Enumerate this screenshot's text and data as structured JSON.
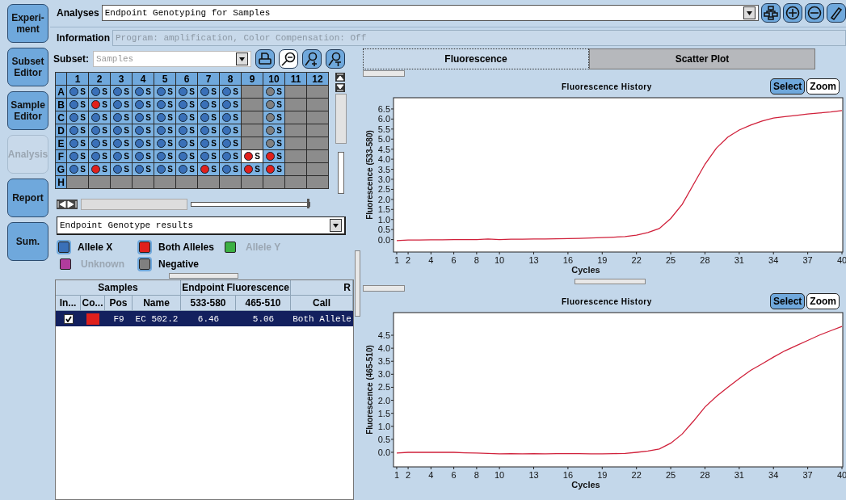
{
  "sidebar": {
    "items": [
      {
        "label": "Experi-ment",
        "disabled": false
      },
      {
        "label": "Subset Editor",
        "disabled": false
      },
      {
        "label": "Sample Editor",
        "disabled": false
      },
      {
        "label": "Analysis",
        "disabled": true
      },
      {
        "label": "Report",
        "disabled": false
      },
      {
        "label": "Sum.",
        "disabled": false
      }
    ]
  },
  "analyses": {
    "label": "Analyses",
    "value": "Endpoint Genotyping for Samples"
  },
  "information": {
    "label": "Information",
    "value": "Program: amplification, Color Compensation: Off"
  },
  "subset": {
    "label": "Subset:",
    "value": "Samples",
    "disabled": true
  },
  "plate": {
    "columns": [
      "1",
      "2",
      "3",
      "4",
      "5",
      "6",
      "7",
      "8",
      "9",
      "10",
      "11",
      "12"
    ],
    "rows": [
      {
        "label": "A",
        "wells": [
          {
            "kind": "allele_x",
            "text": "S",
            "selected": false
          },
          {
            "kind": "allele_x",
            "text": "S",
            "selected": false
          },
          {
            "kind": "allele_x",
            "text": "S",
            "selected": false
          },
          {
            "kind": "allele_x",
            "text": "S",
            "selected": false
          },
          {
            "kind": "allele_x",
            "text": "S",
            "selected": false
          },
          {
            "kind": "allele_x",
            "text": "S",
            "selected": false
          },
          {
            "kind": "allele_x",
            "text": "S",
            "selected": false
          },
          {
            "kind": "allele_x",
            "text": "S",
            "selected": false
          },
          {
            "kind": "empty",
            "selected": false
          },
          {
            "kind": "negative",
            "text": "S",
            "selected": false
          },
          {
            "kind": "empty",
            "selected": false
          },
          {
            "kind": "empty",
            "selected": false
          }
        ]
      },
      {
        "label": "B",
        "wells": [
          {
            "kind": "allele_x",
            "text": "S",
            "selected": false
          },
          {
            "kind": "both",
            "text": "S",
            "selected": false
          },
          {
            "kind": "allele_x",
            "text": "S",
            "selected": false
          },
          {
            "kind": "allele_x",
            "text": "S",
            "selected": false
          },
          {
            "kind": "allele_x",
            "text": "S",
            "selected": false
          },
          {
            "kind": "allele_x",
            "text": "S",
            "selected": false
          },
          {
            "kind": "allele_x",
            "text": "S",
            "selected": false
          },
          {
            "kind": "allele_x",
            "text": "S",
            "selected": false
          },
          {
            "kind": "empty",
            "selected": false
          },
          {
            "kind": "negative",
            "text": "S",
            "selected": false
          },
          {
            "kind": "empty",
            "selected": false
          },
          {
            "kind": "empty",
            "selected": false
          }
        ]
      },
      {
        "label": "C",
        "wells": [
          {
            "kind": "allele_x",
            "text": "S",
            "selected": false
          },
          {
            "kind": "allele_x",
            "text": "S",
            "selected": false
          },
          {
            "kind": "allele_x",
            "text": "S",
            "selected": false
          },
          {
            "kind": "allele_x",
            "text": "S",
            "selected": false
          },
          {
            "kind": "allele_x",
            "text": "S",
            "selected": false
          },
          {
            "kind": "allele_x",
            "text": "S",
            "selected": false
          },
          {
            "kind": "allele_x",
            "text": "S",
            "selected": false
          },
          {
            "kind": "allele_x",
            "text": "S",
            "selected": false
          },
          {
            "kind": "empty",
            "selected": false
          },
          {
            "kind": "negative",
            "text": "S",
            "selected": false
          },
          {
            "kind": "empty",
            "selected": false
          },
          {
            "kind": "empty",
            "selected": false
          }
        ]
      },
      {
        "label": "D",
        "wells": [
          {
            "kind": "allele_x",
            "text": "S",
            "selected": false
          },
          {
            "kind": "allele_x",
            "text": "S",
            "selected": false
          },
          {
            "kind": "allele_x",
            "text": "S",
            "selected": false
          },
          {
            "kind": "allele_x",
            "text": "S",
            "selected": false
          },
          {
            "kind": "allele_x",
            "text": "S",
            "selected": false
          },
          {
            "kind": "allele_x",
            "text": "S",
            "selected": false
          },
          {
            "kind": "allele_x",
            "text": "S",
            "selected": false
          },
          {
            "kind": "allele_x",
            "text": "S",
            "selected": false
          },
          {
            "kind": "empty",
            "selected": false
          },
          {
            "kind": "negative",
            "text": "S",
            "selected": false
          },
          {
            "kind": "empty",
            "selected": false
          },
          {
            "kind": "empty",
            "selected": false
          }
        ]
      },
      {
        "label": "E",
        "wells": [
          {
            "kind": "allele_x",
            "text": "S",
            "selected": false
          },
          {
            "kind": "allele_x",
            "text": "S",
            "selected": false
          },
          {
            "kind": "allele_x",
            "text": "S",
            "selected": false
          },
          {
            "kind": "allele_x",
            "text": "S",
            "selected": false
          },
          {
            "kind": "allele_x",
            "text": "S",
            "selected": false
          },
          {
            "kind": "allele_x",
            "text": "S",
            "selected": false
          },
          {
            "kind": "allele_x",
            "text": "S",
            "selected": false
          },
          {
            "kind": "allele_x",
            "text": "S",
            "selected": false
          },
          {
            "kind": "empty",
            "selected": false
          },
          {
            "kind": "negative",
            "text": "S",
            "selected": false
          },
          {
            "kind": "empty",
            "selected": false
          },
          {
            "kind": "empty",
            "selected": false
          }
        ]
      },
      {
        "label": "F",
        "wells": [
          {
            "kind": "allele_x",
            "text": "S",
            "selected": false
          },
          {
            "kind": "allele_x",
            "text": "S",
            "selected": false
          },
          {
            "kind": "allele_x",
            "text": "S",
            "selected": false
          },
          {
            "kind": "allele_x",
            "text": "S",
            "selected": false
          },
          {
            "kind": "allele_x",
            "text": "S",
            "selected": false
          },
          {
            "kind": "allele_x",
            "text": "S",
            "selected": false
          },
          {
            "kind": "allele_x",
            "text": "S",
            "selected": false
          },
          {
            "kind": "allele_x",
            "text": "S",
            "selected": false
          },
          {
            "kind": "both",
            "text": "S",
            "selected": true
          },
          {
            "kind": "both",
            "text": "S",
            "selected": false
          },
          {
            "kind": "empty",
            "selected": false
          },
          {
            "kind": "empty",
            "selected": false
          }
        ]
      },
      {
        "label": "G",
        "wells": [
          {
            "kind": "allele_x",
            "text": "S",
            "selected": false
          },
          {
            "kind": "both",
            "text": "S",
            "selected": false
          },
          {
            "kind": "allele_x",
            "text": "S",
            "selected": false
          },
          {
            "kind": "allele_x",
            "text": "S",
            "selected": false
          },
          {
            "kind": "allele_x",
            "text": "S",
            "selected": false
          },
          {
            "kind": "allele_x",
            "text": "S",
            "selected": false
          },
          {
            "kind": "both",
            "text": "S",
            "selected": false
          },
          {
            "kind": "allele_x",
            "text": "S",
            "selected": false
          },
          {
            "kind": "both",
            "text": "S",
            "selected": false
          },
          {
            "kind": "both",
            "text": "S",
            "selected": false
          },
          {
            "kind": "empty",
            "selected": false
          },
          {
            "kind": "empty",
            "selected": false
          }
        ]
      },
      {
        "label": "H",
        "wells": [
          {
            "kind": "empty",
            "selected": false
          },
          {
            "kind": "empty",
            "selected": false
          },
          {
            "kind": "empty",
            "selected": false
          },
          {
            "kind": "empty",
            "selected": false
          },
          {
            "kind": "empty",
            "selected": false
          },
          {
            "kind": "empty",
            "selected": false
          },
          {
            "kind": "empty",
            "selected": false
          },
          {
            "kind": "empty",
            "selected": false
          },
          {
            "kind": "empty",
            "selected": false
          },
          {
            "kind": "empty",
            "selected": false
          },
          {
            "kind": "empty",
            "selected": false
          },
          {
            "kind": "empty",
            "selected": false
          }
        ]
      }
    ]
  },
  "zoom_slider": {
    "level": 1
  },
  "results_dropdown": {
    "value": "Endpoint Genotype results"
  },
  "legend": [
    {
      "label": "Allele X",
      "color": "#3a70b8",
      "disabled": false
    },
    {
      "label": "Both Alleles",
      "color": "#e0201c",
      "disabled": false
    },
    {
      "label": "Allele Y",
      "color": "#3cb043",
      "disabled": true
    },
    {
      "label": "Unknown",
      "color": "#b03c9c",
      "disabled": true
    },
    {
      "label": "Negative",
      "color": "#808080",
      "disabled": false
    }
  ],
  "table": {
    "groups": [
      {
        "label": "Samples",
        "columns": [
          "In...",
          "Co...",
          "Pos",
          "Name"
        ]
      },
      {
        "label": "Endpoint Fluorescence",
        "columns": [
          "533-580",
          "465-510"
        ]
      },
      {
        "label": "R",
        "columns": [
          "Call"
        ]
      }
    ],
    "rows": [
      {
        "selected": true,
        "included": true,
        "color": "#e0201c",
        "cells": [
          "F9",
          "EC 502.2",
          "6.46",
          "5.06",
          "Both Allele"
        ]
      }
    ]
  },
  "tabs": [
    {
      "label": "Fluorescence",
      "selected": true
    },
    {
      "label": "Scatter Plot",
      "selected": false
    }
  ],
  "charts": [
    {
      "buttons": [
        {
          "label": "Select",
          "selected": true
        },
        {
          "label": "Zoom",
          "selected": false
        }
      ],
      "chart_data": {
        "type": "line",
        "title": "Fluorescence History",
        "xlabel": "Cycles",
        "ylabel": "Fluorescence (533-580)",
        "x": [
          1,
          2,
          3,
          4,
          5,
          6,
          7,
          8,
          9,
          10,
          11,
          12,
          13,
          14,
          15,
          16,
          17,
          18,
          19,
          20,
          21,
          22,
          23,
          24,
          25,
          26,
          27,
          28,
          29,
          30,
          31,
          32,
          33,
          34,
          35,
          36,
          37,
          38,
          39,
          40
        ],
        "series": [
          {
            "color": "#d0203a",
            "values": [
              -0.05,
              -0.02,
              -0.02,
              -0.01,
              -0.01,
              0,
              0,
              0,
              0.03,
              0,
              0.02,
              0.02,
              0.03,
              0.03,
              0.04,
              0.05,
              0.06,
              0.08,
              0.1,
              0.12,
              0.15,
              0.22,
              0.35,
              0.55,
              1.05,
              1.75,
              2.75,
              3.75,
              4.55,
              5.1,
              5.45,
              5.7,
              5.9,
              6.05,
              6.12,
              6.18,
              6.25,
              6.3,
              6.35,
              6.42
            ]
          }
        ],
        "xlim": [
          0.72,
          40.07
        ],
        "ylim": [
          -0.62,
          7.06
        ],
        "xticks": [
          1,
          2,
          4,
          6,
          8,
          10,
          13,
          16,
          19,
          22,
          25,
          28,
          31,
          34,
          37,
          40
        ],
        "yticks": [
          {
            "value": 0,
            "label": "0.0"
          },
          {
            "value": 0.5,
            "label": "0.5"
          },
          {
            "value": 1,
            "label": "1.0"
          },
          {
            "value": 1.5,
            "label": "1.5"
          },
          {
            "value": 2,
            "label": "2.0"
          },
          {
            "value": 2.5,
            "label": "2.5"
          },
          {
            "value": 3,
            "label": "3.0"
          },
          {
            "value": 3.5,
            "label": "3.5"
          },
          {
            "value": 4,
            "label": "4.0"
          },
          {
            "value": 4.5,
            "label": "4.5"
          },
          {
            "value": 5,
            "label": "5.0"
          },
          {
            "value": 5.5,
            "label": "5.5"
          },
          {
            "value": 6,
            "label": "6.0"
          },
          {
            "value": 6.5,
            "label": "6.5"
          }
        ]
      }
    },
    {
      "buttons": [
        {
          "label": "Select",
          "selected": true
        },
        {
          "label": "Zoom",
          "selected": false
        }
      ],
      "chart_data": {
        "type": "line",
        "title": "Fluorescence History",
        "xlabel": "Cycles",
        "ylabel": "Fluorescence (465-510)",
        "x": [
          1,
          2,
          3,
          4,
          5,
          6,
          7,
          8,
          9,
          10,
          11,
          12,
          13,
          14,
          15,
          16,
          17,
          18,
          19,
          20,
          21,
          22,
          23,
          24,
          25,
          26,
          27,
          28,
          29,
          30,
          31,
          32,
          33,
          34,
          35,
          36,
          37,
          38,
          39,
          40
        ],
        "series": [
          {
            "color": "#d0203a",
            "values": [
              -0.03,
              0,
              0,
              0,
              0,
              0,
              -0.02,
              -0.03,
              -0.04,
              -0.06,
              -0.05,
              -0.06,
              -0.05,
              -0.06,
              -0.05,
              -0.05,
              -0.05,
              -0.06,
              -0.06,
              -0.05,
              -0.04,
              0,
              0.05,
              0.13,
              0.35,
              0.7,
              1.2,
              1.74,
              2.15,
              2.5,
              2.83,
              3.15,
              3.4,
              3.66,
              3.9,
              4.1,
              4.3,
              4.5,
              4.67,
              4.84
            ]
          }
        ],
        "xlim": [
          0.72,
          40.07
        ],
        "ylim": [
          -0.56,
          5.37
        ],
        "xticks": [
          1,
          2,
          4,
          6,
          8,
          10,
          13,
          16,
          19,
          22,
          25,
          28,
          31,
          34,
          37,
          40
        ],
        "yticks": [
          {
            "value": 0,
            "label": "0.0"
          },
          {
            "value": 0.5,
            "label": "0.5"
          },
          {
            "value": 1,
            "label": "1.0"
          },
          {
            "value": 1.5,
            "label": "1.5"
          },
          {
            "value": 2,
            "label": "2.0"
          },
          {
            "value": 2.5,
            "label": "2.5"
          },
          {
            "value": 3,
            "label": "3.0"
          },
          {
            "value": 3.5,
            "label": "3.5"
          },
          {
            "value": 4,
            "label": "4.0"
          },
          {
            "value": 4.5,
            "label": "4.5"
          }
        ]
      }
    }
  ]
}
